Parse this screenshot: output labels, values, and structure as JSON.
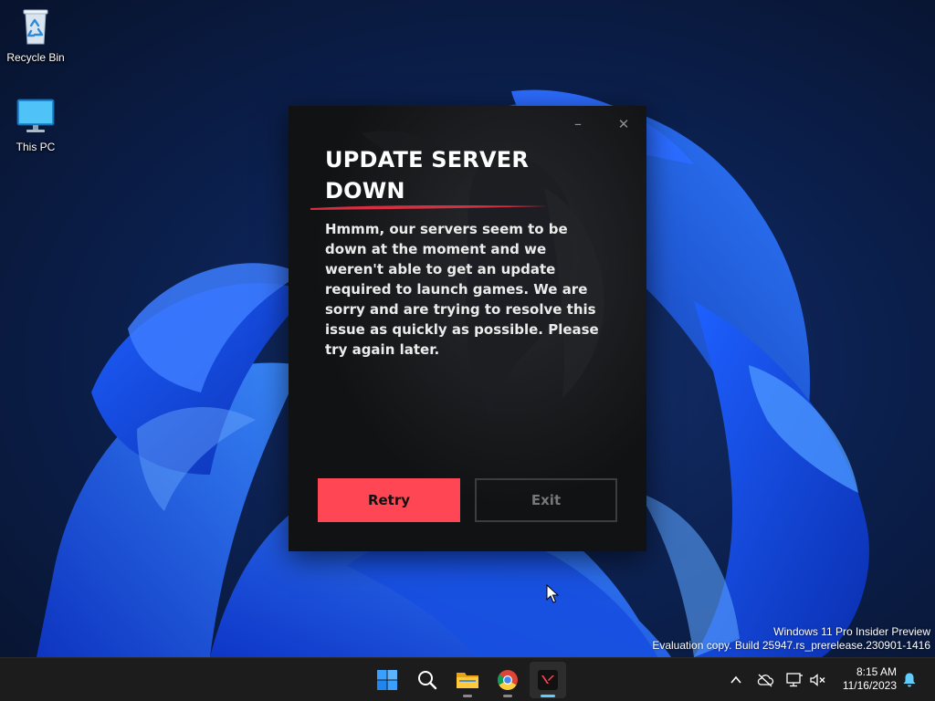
{
  "desktop": {
    "icons": [
      {
        "label": "Recycle Bin",
        "icon": "recycle-bin-icon"
      },
      {
        "label": "This PC",
        "icon": "monitor-icon"
      }
    ]
  },
  "dialog": {
    "title": "UPDATE SERVER DOWN",
    "message": "Hmmm, our servers seem to be down at the moment and we weren't able to get an update required to launch games. We are sorry and are trying to resolve this issue as quickly as possible. Please try again later.",
    "minimize_glyph": "–",
    "close_glyph": "✕",
    "retry_label": "Retry",
    "exit_label": "Exit",
    "colors": {
      "accent": "#ff4655",
      "background": "#111214",
      "exit_border": "#3b3d42"
    }
  },
  "watermark": {
    "line1": "Windows 11 Pro Insider Preview",
    "line2": "Evaluation copy. Build 25947.rs_prerelease.230901-1416"
  },
  "taskbar": {
    "apps": [
      {
        "name": "start",
        "icon": "windows-logo-icon"
      },
      {
        "name": "search",
        "icon": "search-icon"
      },
      {
        "name": "file-explorer",
        "icon": "folder-icon"
      },
      {
        "name": "chrome",
        "icon": "chrome-icon"
      },
      {
        "name": "riot-client",
        "icon": "valorant-icon",
        "active": true
      }
    ],
    "tray": {
      "icons": [
        "chevron-up-icon",
        "cloud-off-icon",
        "network-icon",
        "volume-muted-icon",
        "notification-bell-icon"
      ],
      "time": "8:15 AM",
      "date": "11/16/2023"
    }
  }
}
